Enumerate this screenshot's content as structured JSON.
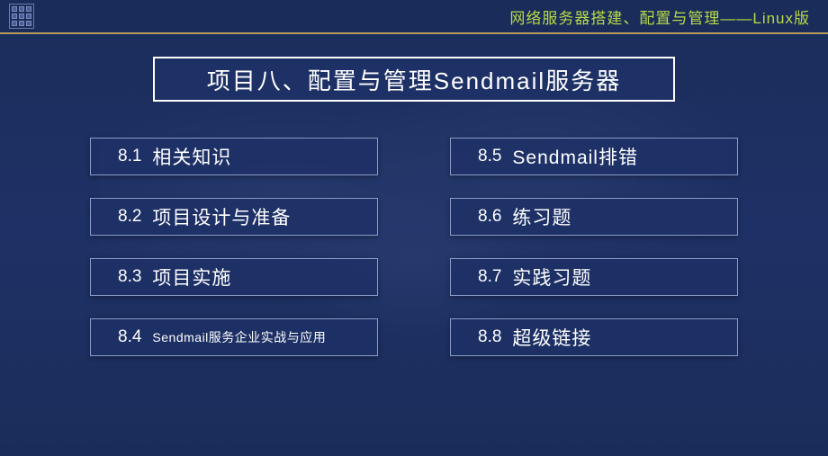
{
  "header": {
    "text": "网络服务器搭建、配置与管理——Linux版"
  },
  "title": "项目八、配置与管理Sendmail服务器",
  "leftColumn": [
    {
      "num": "8.1",
      "label": "相关知识",
      "small": false
    },
    {
      "num": "8.2",
      "label": "项目设计与准备",
      "small": false
    },
    {
      "num": "8.3",
      "label": "项目实施",
      "small": false
    },
    {
      "num": "8.4",
      "label": "Sendmail服务企业实战与应用",
      "small": true
    }
  ],
  "rightColumn": [
    {
      "num": "8.5",
      "label": "Sendmail排错",
      "small": false
    },
    {
      "num": "8.6",
      "label": "练习题",
      "small": false
    },
    {
      "num": "8.7",
      "label": "实践习题",
      "small": false
    },
    {
      "num": "8.8",
      "label": "超级链接",
      "small": false
    }
  ]
}
